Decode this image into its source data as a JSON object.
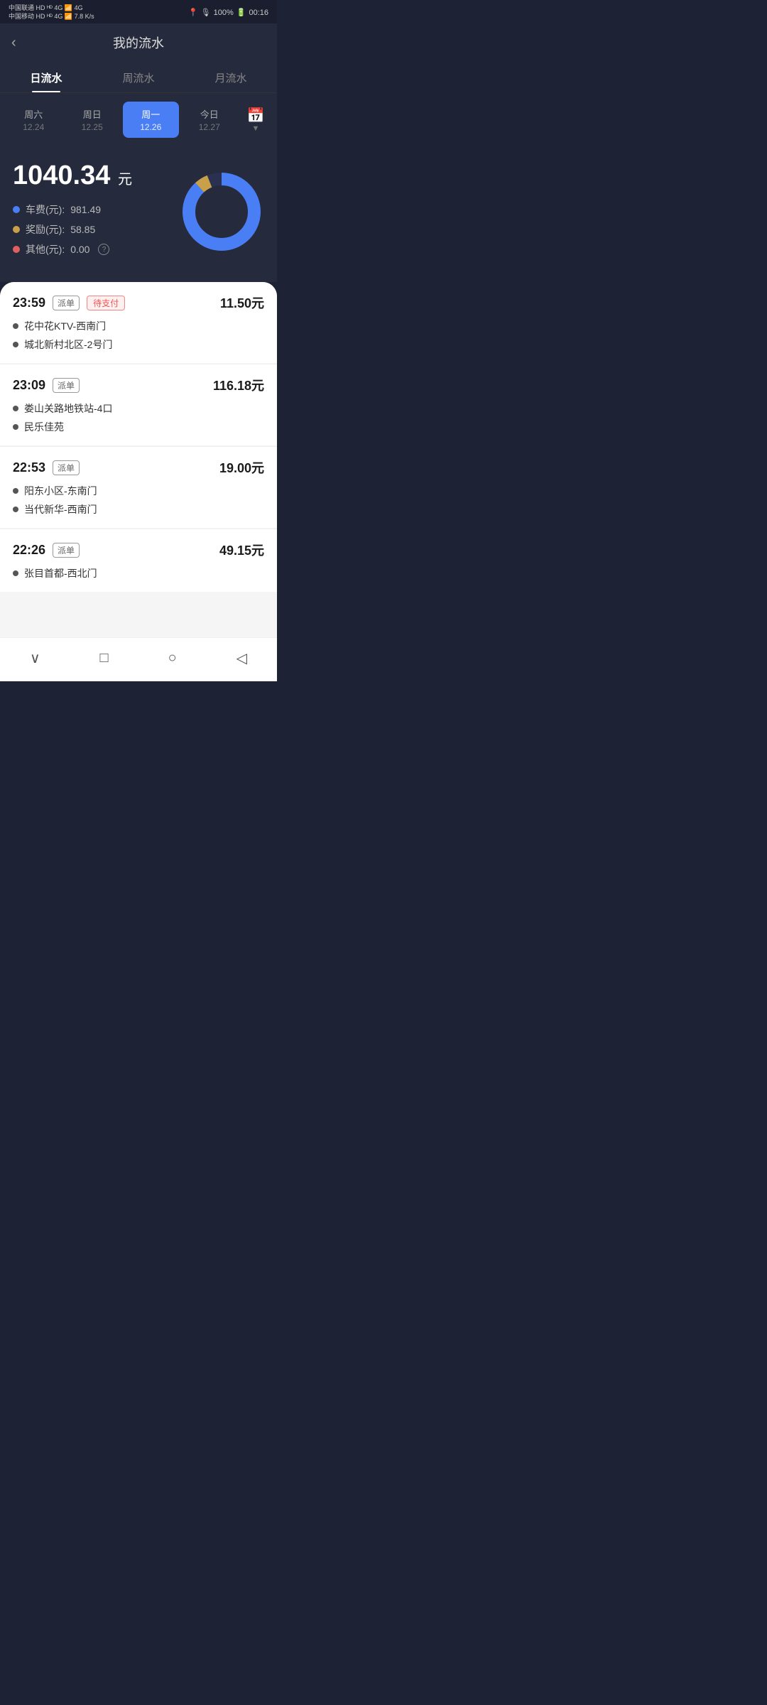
{
  "statusBar": {
    "carrier": "中国联通 HD 4G 中国移动 HD 4G",
    "speed": "7.8 K/s",
    "battery": "100%",
    "time": "00:16"
  },
  "header": {
    "backLabel": "‹",
    "title": "我的流水"
  },
  "tabs": [
    {
      "id": "day",
      "label": "日流水",
      "active": true
    },
    {
      "id": "week",
      "label": "周流水",
      "active": false
    },
    {
      "id": "month",
      "label": "月流水",
      "active": false
    }
  ],
  "days": [
    {
      "id": "sat",
      "name": "周六",
      "date": "12.24",
      "active": false
    },
    {
      "id": "sun",
      "name": "周日",
      "date": "12.25",
      "active": false
    },
    {
      "id": "mon",
      "name": "周一",
      "date": "12.26",
      "active": true
    },
    {
      "id": "today",
      "name": "今日",
      "date": "12.27",
      "active": false
    }
  ],
  "stats": {
    "total": "1040.34",
    "unit": "元",
    "items": [
      {
        "id": "fare",
        "label": "车费(元):",
        "value": "981.49",
        "dotClass": "dot-blue"
      },
      {
        "id": "bonus",
        "label": "奖励(元):",
        "value": "58.85",
        "dotClass": "dot-gold"
      },
      {
        "id": "other",
        "label": "其他(元):",
        "value": "0.00",
        "dotClass": "dot-red",
        "hasInfo": true
      }
    ],
    "chart": {
      "farePercent": 94.3,
      "bonusPercent": 5.7
    }
  },
  "orders": [
    {
      "id": "order1",
      "time": "23:59",
      "badge": "派单",
      "pending": true,
      "pendingLabel": "待支付",
      "amount": "11.50元",
      "from": "花中花KTV-西南门",
      "to": "城北新村北区-2号门"
    },
    {
      "id": "order2",
      "time": "23:09",
      "badge": "派单",
      "pending": false,
      "amount": "116.18元",
      "from": "娄山关路地铁站-4口",
      "to": "民乐佳苑"
    },
    {
      "id": "order3",
      "time": "22:53",
      "badge": "派单",
      "pending": false,
      "amount": "19.00元",
      "from": "阳东小区-东南门",
      "to": "当代新华-西南门"
    },
    {
      "id": "order4",
      "time": "22:26",
      "badge": "派单",
      "pending": false,
      "amount": "49.15元",
      "from": "张目首都-西北门",
      "to": ""
    }
  ],
  "bottomNav": {
    "chevronDown": "∨",
    "square": "□",
    "circle": "○",
    "triangle": "◁"
  }
}
